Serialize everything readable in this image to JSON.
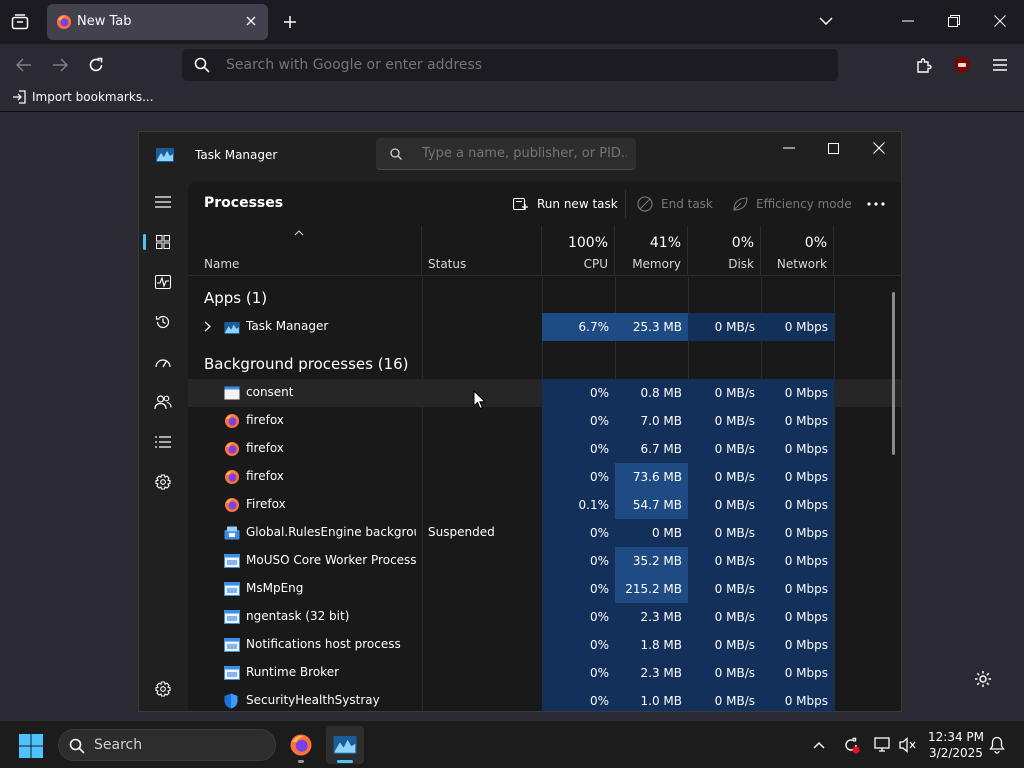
{
  "browser": {
    "tab_title": "New Tab",
    "urlbar_placeholder": "Search with Google or enter address",
    "bookmark_import_label": "Import bookmarks..."
  },
  "task_manager": {
    "title": "Task Manager",
    "search_placeholder": "Type a name, publisher, or PID...",
    "heading": "Processes",
    "commands": {
      "run_new_task": "Run new task",
      "end_task": "End task",
      "efficiency_mode": "Efficiency mode"
    },
    "columns": {
      "name": "Name",
      "status": "Status",
      "cpu": {
        "pct": "100%",
        "label": "CPU"
      },
      "memory": {
        "pct": "41%",
        "label": "Memory"
      },
      "disk": {
        "pct": "0%",
        "label": "Disk"
      },
      "network": {
        "pct": "0%",
        "label": "Network"
      }
    },
    "groups": {
      "apps": "Apps (1)",
      "background": "Background processes (16)"
    },
    "apps": [
      {
        "name": "Task Manager",
        "status": "",
        "cpu": "6.7%",
        "memory": "25.3 MB",
        "disk": "0 MB/s",
        "network": "0 Mbps",
        "icon": "task-manager-icon"
      }
    ],
    "background": [
      {
        "name": "consent",
        "status": "",
        "cpu": "0%",
        "memory": "0.8 MB",
        "disk": "0 MB/s",
        "network": "0 Mbps",
        "icon": "window-icon"
      },
      {
        "name": "firefox",
        "status": "",
        "cpu": "0%",
        "memory": "7.0 MB",
        "disk": "0 MB/s",
        "network": "0 Mbps",
        "icon": "firefox-icon"
      },
      {
        "name": "firefox",
        "status": "",
        "cpu": "0%",
        "memory": "6.7 MB",
        "disk": "0 MB/s",
        "network": "0 Mbps",
        "icon": "firefox-icon"
      },
      {
        "name": "firefox",
        "status": "",
        "cpu": "0%",
        "memory": "73.6 MB",
        "disk": "0 MB/s",
        "network": "0 Mbps",
        "icon": "firefox-icon"
      },
      {
        "name": "Firefox",
        "status": "",
        "cpu": "0.1%",
        "memory": "54.7 MB",
        "disk": "0 MB/s",
        "network": "0 Mbps",
        "icon": "firefox-icon"
      },
      {
        "name": "Global.RulesEngine backgrou...",
        "status": "Suspended",
        "cpu": "0%",
        "memory": "0 MB",
        "disk": "0 MB/s",
        "network": "0 Mbps",
        "icon": "rules-engine-icon"
      },
      {
        "name": "MoUSO Core Worker Process",
        "status": "",
        "cpu": "0%",
        "memory": "35.2 MB",
        "disk": "0 MB/s",
        "network": "0 Mbps",
        "icon": "service-icon"
      },
      {
        "name": "MsMpEng",
        "status": "",
        "cpu": "0%",
        "memory": "215.2 MB",
        "disk": "0 MB/s",
        "network": "0 Mbps",
        "icon": "service-icon"
      },
      {
        "name": "ngentask (32 bit)",
        "status": "",
        "cpu": "0%",
        "memory": "2.3 MB",
        "disk": "0 MB/s",
        "network": "0 Mbps",
        "icon": "service-icon"
      },
      {
        "name": "Notifications host process",
        "status": "",
        "cpu": "0%",
        "memory": "1.8 MB",
        "disk": "0 MB/s",
        "network": "0 Mbps",
        "icon": "service-icon"
      },
      {
        "name": "Runtime Broker",
        "status": "",
        "cpu": "0%",
        "memory": "2.3 MB",
        "disk": "0 MB/s",
        "network": "0 Mbps",
        "icon": "service-icon"
      },
      {
        "name": "SecurityHealthSystray",
        "status": "",
        "cpu": "0%",
        "memory": "1.0 MB",
        "disk": "0 MB/s",
        "network": "0 Mbps",
        "icon": "shield-icon"
      }
    ]
  },
  "taskbar": {
    "search_label": "Search",
    "time": "12:34 PM",
    "date": "3/2/2025"
  },
  "colors": {
    "accent": "#4cc2ff",
    "heat_low": "#12305a",
    "heat_high": "#1f4b85",
    "tm_bg": "#191919"
  }
}
